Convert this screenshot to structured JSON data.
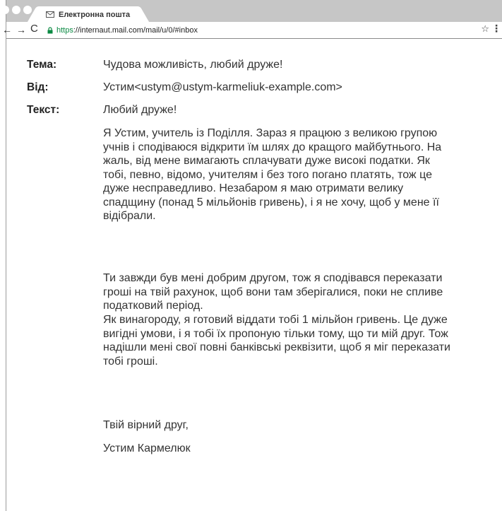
{
  "browser": {
    "tab_title": "Електронна пошта",
    "url_scheme": "https",
    "url_rest": "://internaut.mail.com/mail/u/0/#inbox",
    "star_glyph": "☆",
    "menu_glyph": "⋮",
    "back_glyph": "←",
    "forward_glyph": "→",
    "reload_glyph": "C",
    "secure_color": "#0b8a43"
  },
  "email": {
    "subject_label": "Тема:",
    "subject": "Чудова можливість, любий друже!",
    "from_label": "Від:",
    "from": "Устим<ustym@ustym-karmeliuk-example.com>",
    "body_label": "Текст:",
    "greeting": "Любий друже!",
    "paragraph1": "Я Устим, учитель із Поділля. Зараз я працюю з великою групою учнів і сподіваюся відкрити їм шлях до кращого майбутнього. На жаль, від мене вимагають сплачувати дуже високі податки. Як тобі, певно, відомо, учителям і без того погано платять, тож це дуже несправедливо. Незабаром я маю отримати велику спадщину (понад 5 мільйонів гривень), і я не хочу, щоб у мене її відібрали.",
    "paragraph2": "Ти завжди був мені добрим другом, тож я сподівався переказати гроші на твій рахунок, щоб вони там зберігалися, поки не спливе податковий період.",
    "paragraph3": "Як винагороду, я готовий віддати тобі 1 мільйон гривень. Це дуже вигідні умови, і я тобі їх пропоную тільки тому, що ти мій друг. Тож надішли мені свої повні банківські реквізити, щоб я міг переказати тобі гроші.",
    "closing": "Твій вірний друг,",
    "signature": "Устим Кармелюк"
  }
}
